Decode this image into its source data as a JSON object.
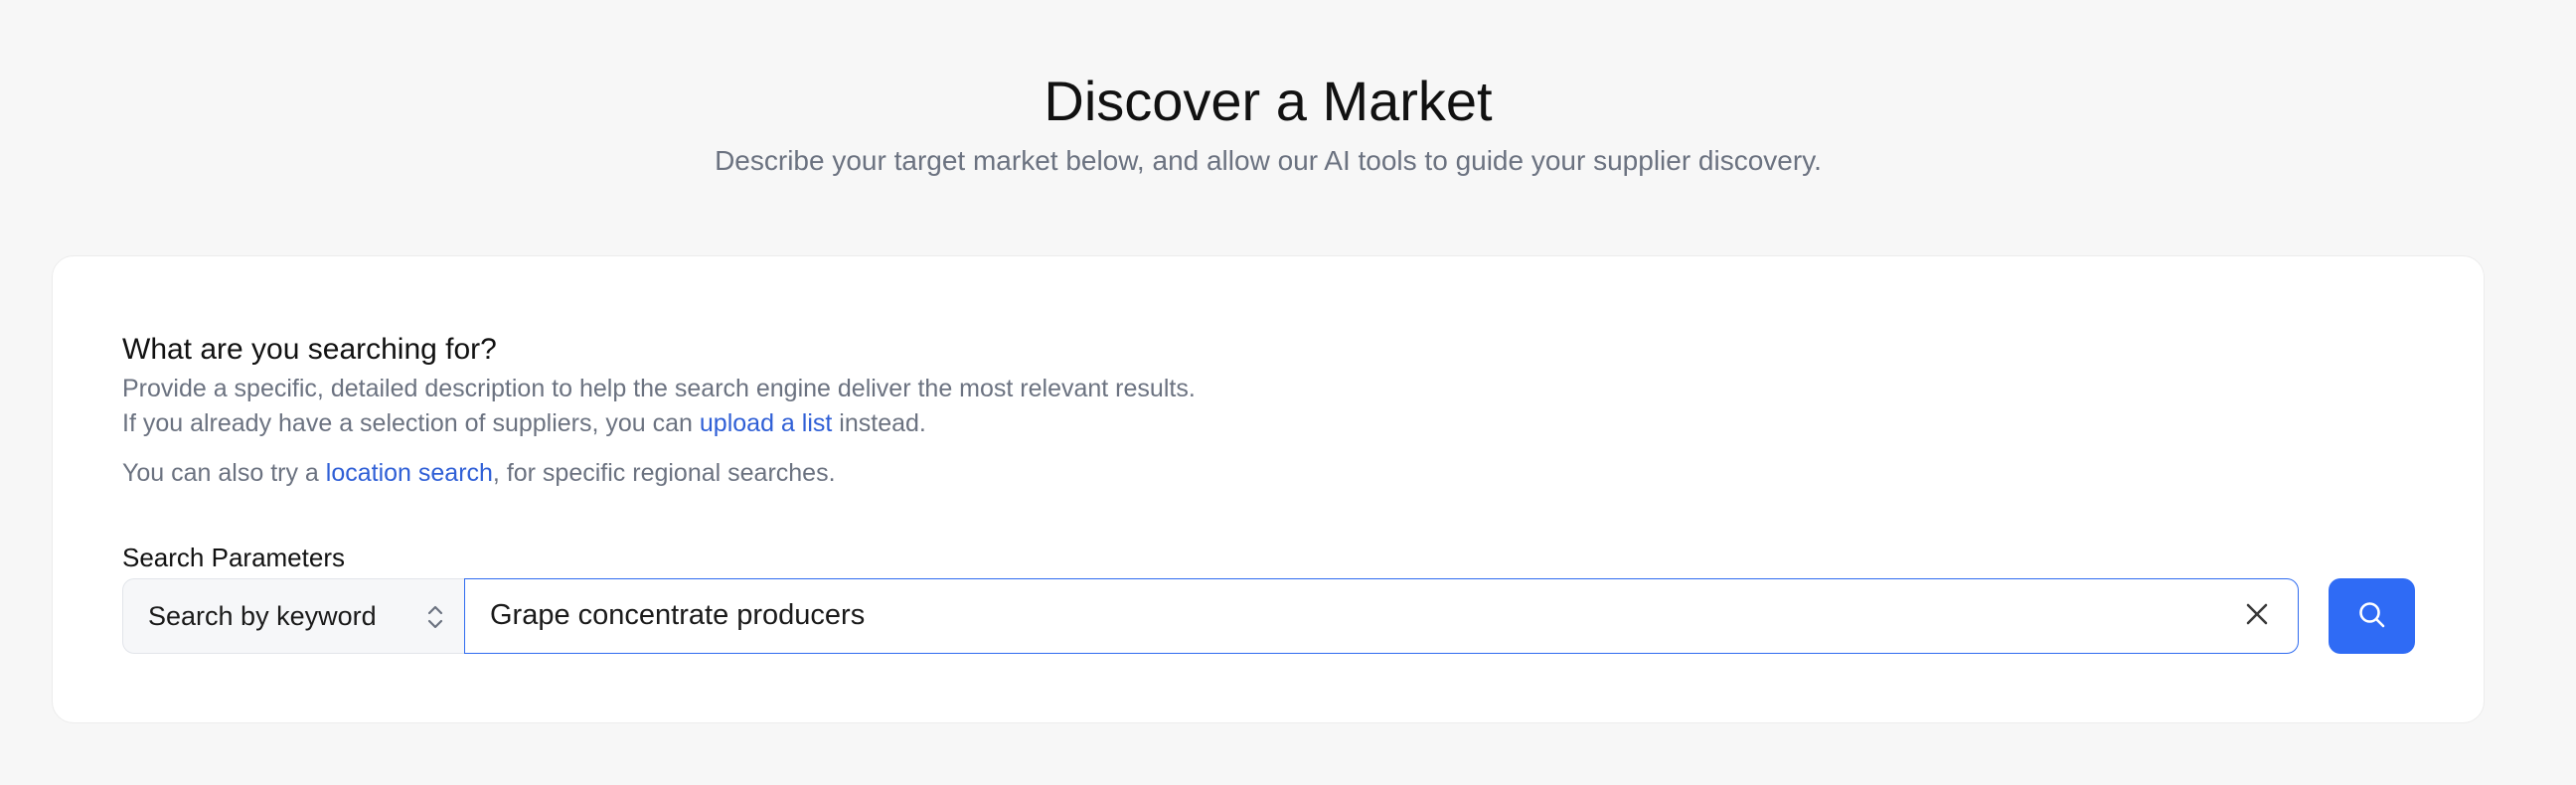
{
  "header": {
    "title": "Discover a Market",
    "subtitle": "Describe your target market below, and allow our AI tools to guide your supplier discovery."
  },
  "form": {
    "heading": "What are you searching for?",
    "description_line1": "Provide a specific, detailed description to help the search engine deliver the most relevant results.",
    "description_line2_prefix": "If you already have a selection of suppliers, you can ",
    "upload_link": "upload a list",
    "description_line2_suffix": " instead.",
    "description_line3_prefix": "You can also try a ",
    "location_link": "location search",
    "description_line3_suffix": ", for specific regional searches.",
    "params_label": "Search Parameters",
    "search_type": "Search by keyword",
    "search_value": "Grape concentrate producers"
  },
  "icons": {
    "select": "chevron-up-down-icon",
    "clear": "close-icon",
    "search": "search-icon"
  },
  "colors": {
    "accent": "#2f6bf5",
    "link": "#2f5fd6",
    "muted_text": "#6b7280",
    "background": "#f7f7f7"
  }
}
